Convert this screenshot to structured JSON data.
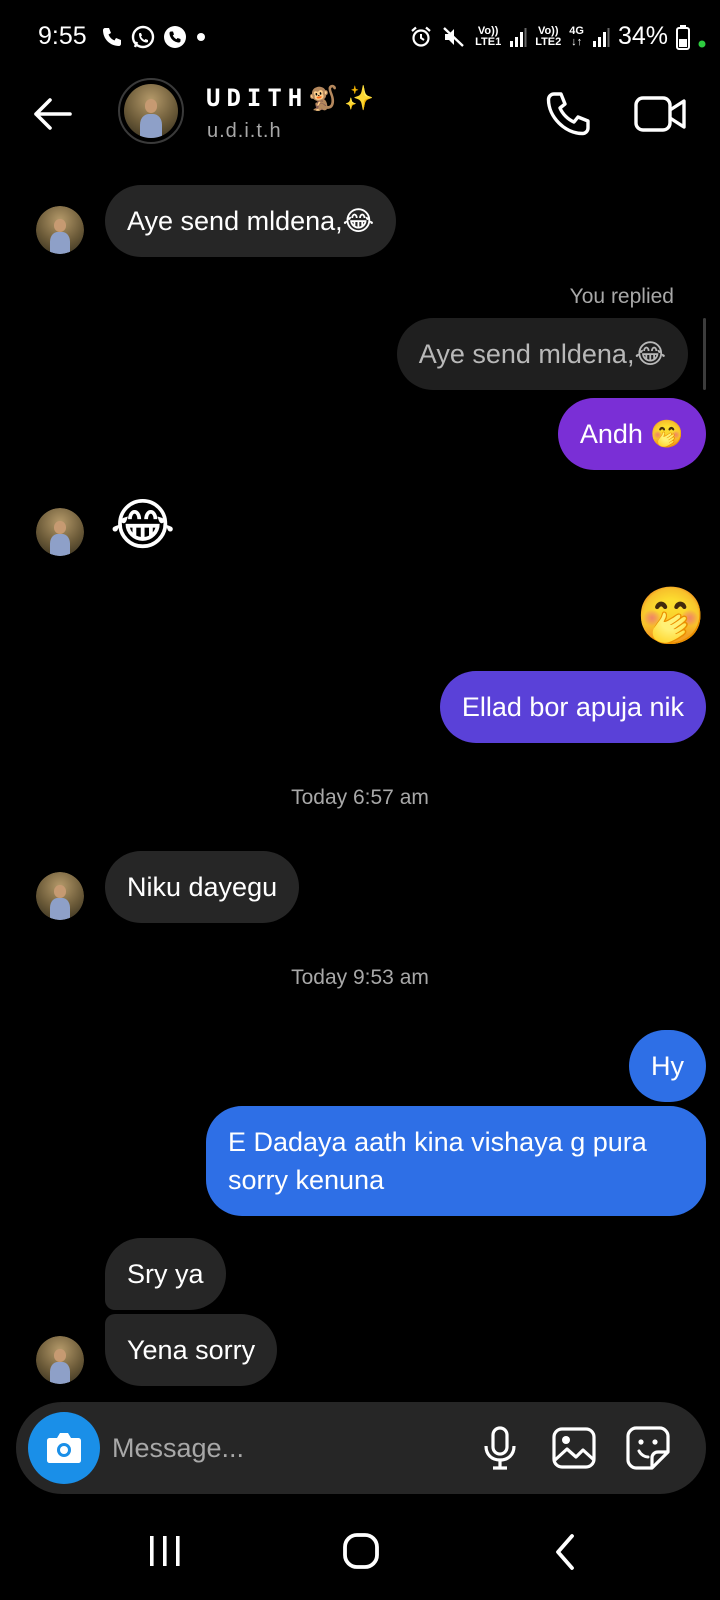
{
  "status_bar": {
    "time": "9:55",
    "sim1_tag_top": "Vo))",
    "sim1_tag_bottom": "LTE1",
    "sim2_tag_top": "Vo))",
    "sim2_tag_bottom": "LTE2",
    "network_type": "4G",
    "battery": "34%"
  },
  "header": {
    "name": "UDITH🐒✨",
    "username": "u.d.i.t.h"
  },
  "messages": {
    "m1": "Aye send mldena,😂",
    "reply_label": "You replied",
    "quoted": "Aye send mldena,😂",
    "m2": "Andh 🤭",
    "m3_emoji": "😂",
    "m4_emoji": "🤭",
    "m5": "Ellad bor apuja nik",
    "ts1": "Today 6:57 am",
    "m6": "Niku dayegu",
    "ts2": "Today 9:53 am",
    "m7": "Hy",
    "m8": "E Dadaya aath kina vishaya g pura sorry kenuna",
    "m9": "Sry ya",
    "m10": "Yena sorry"
  },
  "composer": {
    "placeholder": "Message..."
  },
  "colors": {
    "background": "#000000",
    "incoming_bubble": "#262626",
    "outgoing_purple": "#7a2fd6",
    "outgoing_violet": "#5a41d8",
    "outgoing_blue": "#2e6fe6",
    "camera_button": "#1a8fe8"
  },
  "icons": [
    "back-arrow-icon",
    "phone-icon",
    "video-camera-icon",
    "camera-icon",
    "microphone-icon",
    "gallery-icon",
    "sticker-icon",
    "recents-icon",
    "home-icon",
    "nav-back-icon"
  ]
}
